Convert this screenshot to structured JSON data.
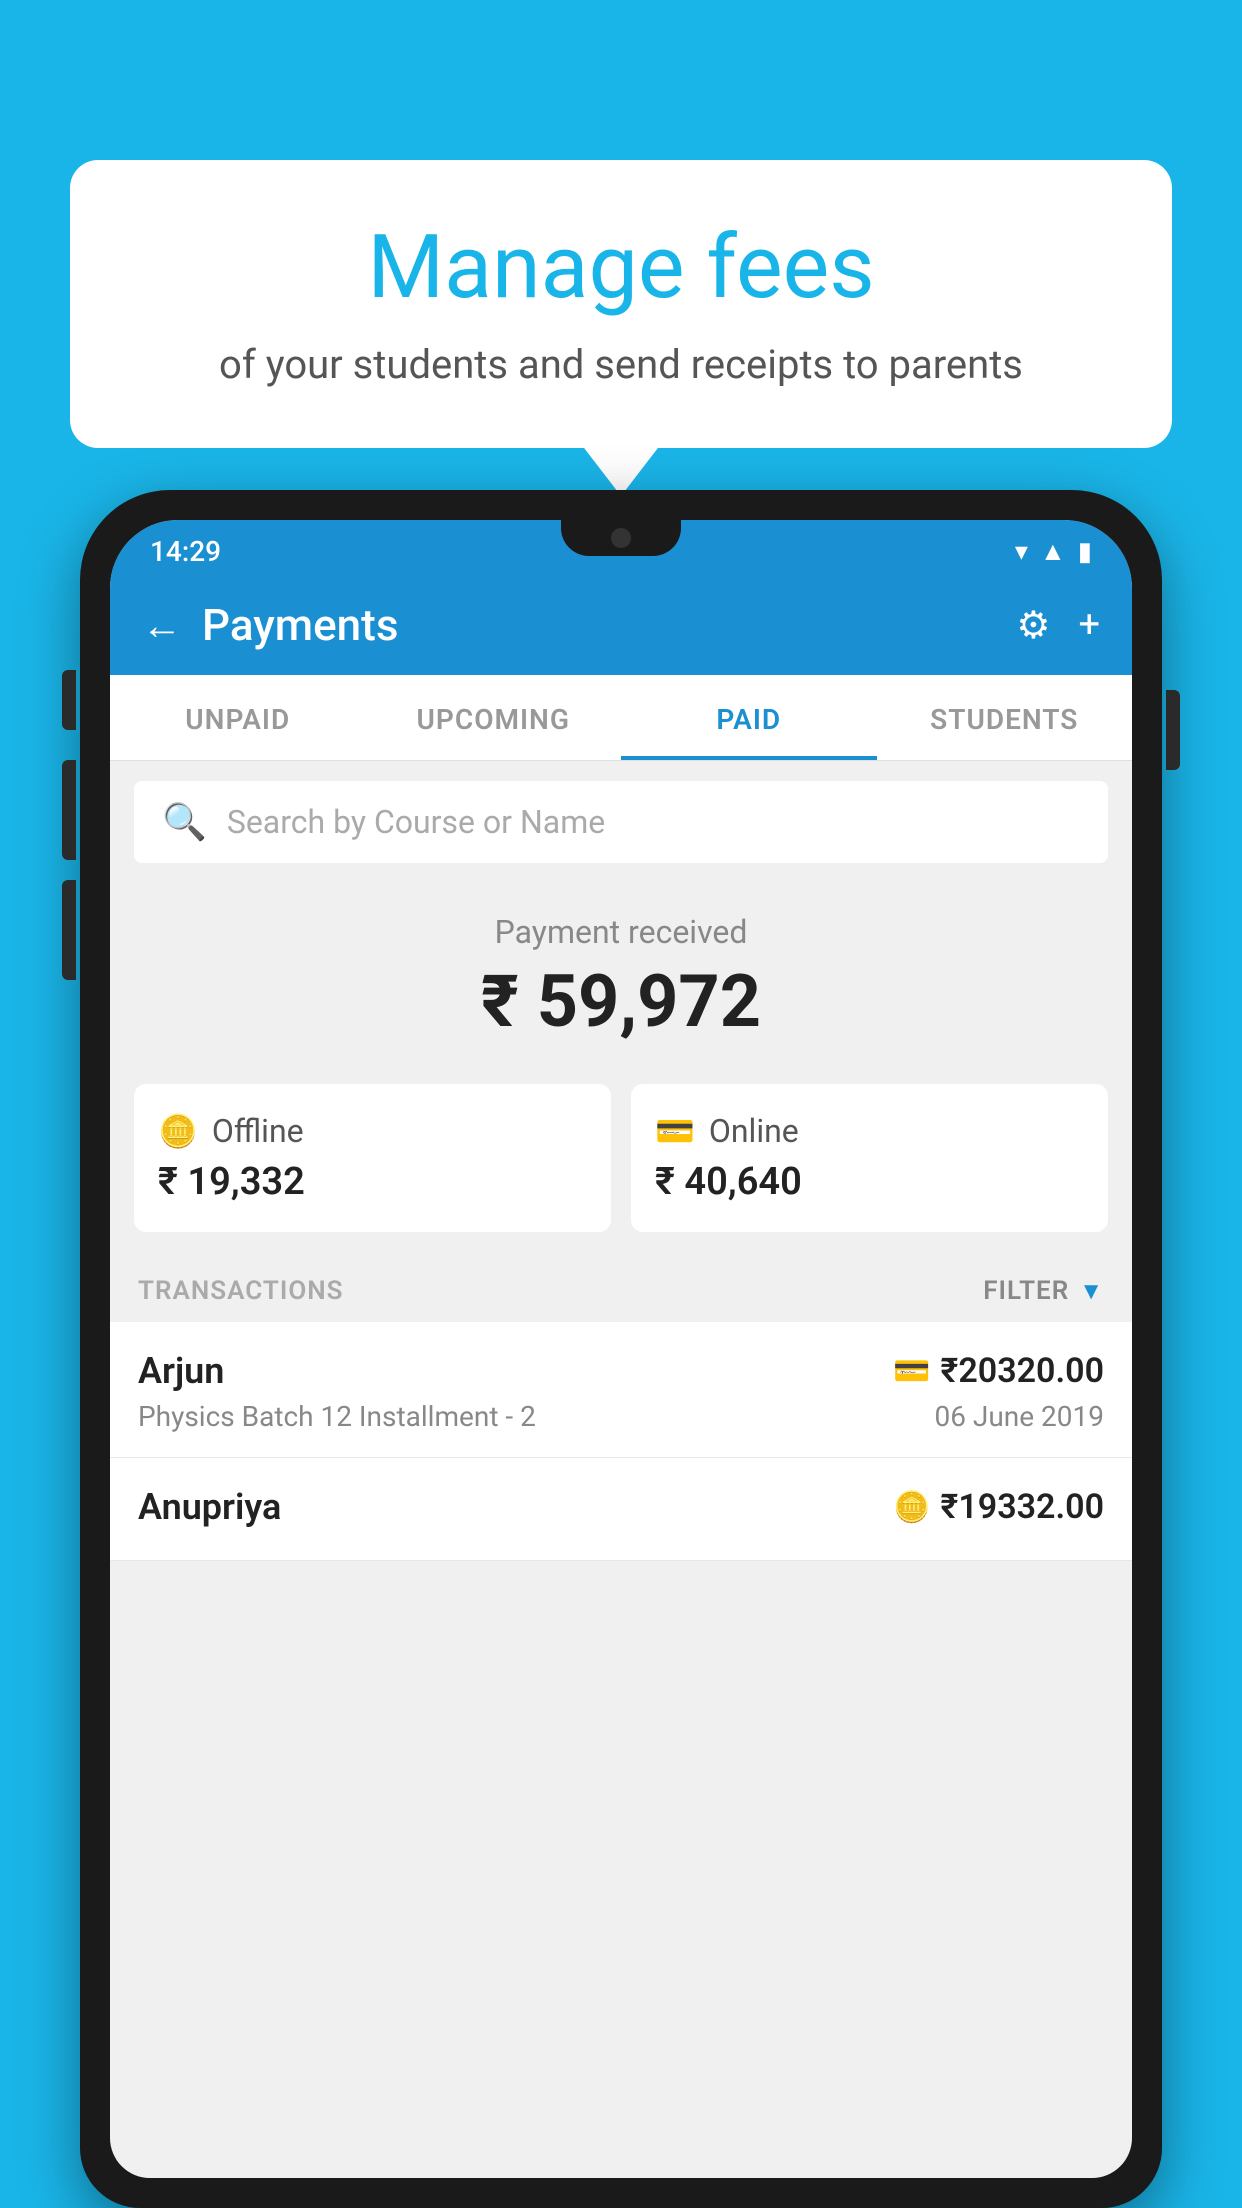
{
  "background_color": "#1ab5e8",
  "speech_bubble": {
    "title": "Manage fees",
    "subtitle": "of your students and send receipts to parents"
  },
  "phone": {
    "status_bar": {
      "time": "14:29",
      "wifi_icon": "wifi",
      "signal_icon": "signal",
      "battery_icon": "battery"
    },
    "app_bar": {
      "back_label": "←",
      "title": "Payments",
      "settings_icon": "⚙",
      "add_icon": "+"
    },
    "tabs": [
      {
        "label": "UNPAID",
        "active": false
      },
      {
        "label": "UPCOMING",
        "active": false
      },
      {
        "label": "PAID",
        "active": true
      },
      {
        "label": "STUDENTS",
        "active": false
      }
    ],
    "search": {
      "placeholder": "Search by Course or Name"
    },
    "payment_received": {
      "label": "Payment received",
      "amount": "₹ 59,972"
    },
    "payment_methods": [
      {
        "icon": "💴",
        "label": "Offline",
        "amount": "₹ 19,332"
      },
      {
        "icon": "💳",
        "label": "Online",
        "amount": "₹ 40,640"
      }
    ],
    "transactions": {
      "header": "TRANSACTIONS",
      "filter_label": "FILTER",
      "items": [
        {
          "name": "Arjun",
          "detail": "Physics Batch 12 Installment - 2",
          "amount": "₹20320.00",
          "date": "06 June 2019",
          "payment_type_icon": "💳"
        },
        {
          "name": "Anupriya",
          "detail": "",
          "amount": "₹19332.00",
          "date": "",
          "payment_type_icon": "💴"
        }
      ]
    }
  }
}
